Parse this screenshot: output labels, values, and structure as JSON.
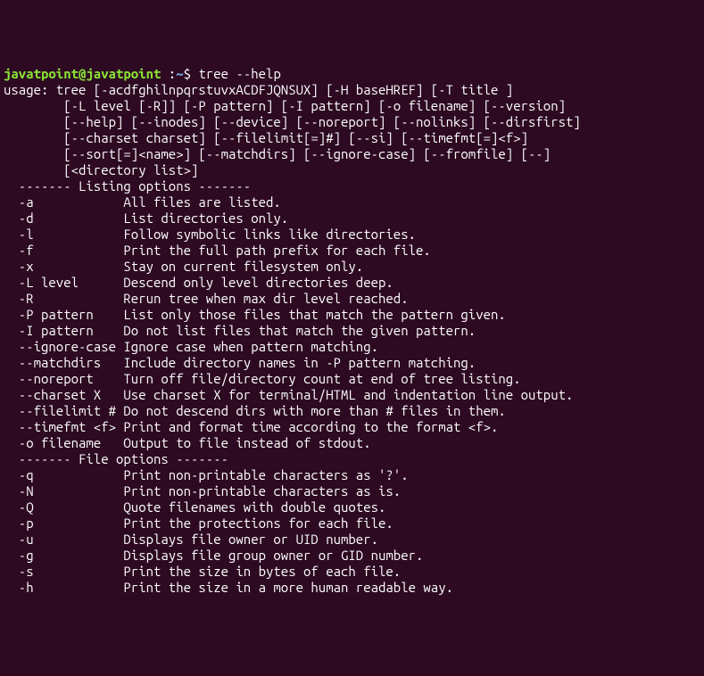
{
  "prompt": {
    "user_host": "javatpoint@javatpoint",
    "separator": " :",
    "path": "~",
    "suffix": "$ ",
    "command": "tree --help"
  },
  "usage": [
    "usage: tree [-acdfghilnpqrstuvxACDFJQNSUX] [-H baseHREF] [-T title ]",
    "        [-L level [-R]] [-P pattern] [-I pattern] [-o filename] [--version]",
    "        [--help] [--inodes] [--device] [--noreport] [--nolinks] [--dirsfirst]",
    "        [--charset charset] [--filelimit[=]#] [--si] [--timefmt[=]<f>]",
    "        [--sort[=]<name>] [--matchdirs] [--ignore-case] [--fromfile] [--]",
    "        [<directory list>]"
  ],
  "sections": [
    {
      "header": "  ------- Listing options -------",
      "options": [
        {
          "flag": "  -a            ",
          "desc": "All files are listed."
        },
        {
          "flag": "  -d            ",
          "desc": "List directories only."
        },
        {
          "flag": "  -l            ",
          "desc": "Follow symbolic links like directories."
        },
        {
          "flag": "  -f            ",
          "desc": "Print the full path prefix for each file."
        },
        {
          "flag": "  -x            ",
          "desc": "Stay on current filesystem only."
        },
        {
          "flag": "  -L level      ",
          "desc": "Descend only level directories deep."
        },
        {
          "flag": "  -R            ",
          "desc": "Rerun tree when max dir level reached."
        },
        {
          "flag": "  -P pattern    ",
          "desc": "List only those files that match the pattern given."
        },
        {
          "flag": "  -I pattern    ",
          "desc": "Do not list files that match the given pattern."
        },
        {
          "flag": "  --ignore-case ",
          "desc": "Ignore case when pattern matching."
        },
        {
          "flag": "  --matchdirs   ",
          "desc": "Include directory names in -P pattern matching."
        },
        {
          "flag": "  --noreport    ",
          "desc": "Turn off file/directory count at end of tree listing."
        },
        {
          "flag": "  --charset X   ",
          "desc": "Use charset X for terminal/HTML and indentation line output."
        },
        {
          "flag": "  --filelimit # ",
          "desc": "Do not descend dirs with more than # files in them."
        },
        {
          "flag": "  --timefmt <f> ",
          "desc": "Print and format time according to the format <f>."
        },
        {
          "flag": "  -o filename   ",
          "desc": "Output to file instead of stdout."
        }
      ]
    },
    {
      "header": "  ------- File options -------",
      "options": [
        {
          "flag": "  -q            ",
          "desc": "Print non-printable characters as '?'."
        },
        {
          "flag": "  -N            ",
          "desc": "Print non-printable characters as is."
        },
        {
          "flag": "  -Q            ",
          "desc": "Quote filenames with double quotes."
        },
        {
          "flag": "  -p            ",
          "desc": "Print the protections for each file."
        },
        {
          "flag": "  -u            ",
          "desc": "Displays file owner or UID number."
        },
        {
          "flag": "  -g            ",
          "desc": "Displays file group owner or GID number."
        },
        {
          "flag": "  -s            ",
          "desc": "Print the size in bytes of each file."
        },
        {
          "flag": "  -h            ",
          "desc": "Print the size in a more human readable way."
        }
      ]
    }
  ]
}
